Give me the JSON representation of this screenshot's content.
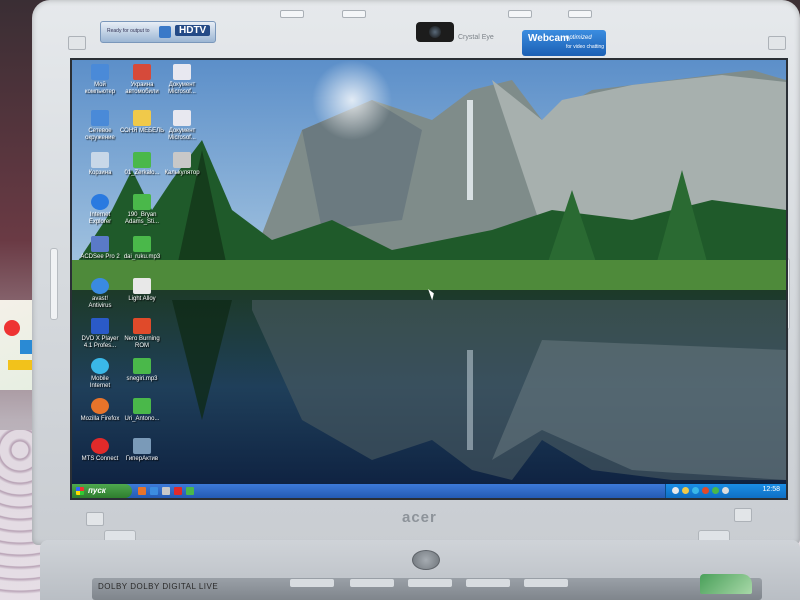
{
  "bezel": {
    "brand": "acer",
    "camera_label": "Crystal Eye",
    "hdtv_sticker": {
      "small_text": "Ready for output to",
      "badge": "HDTV"
    },
    "webcam_sticker": {
      "title": "Webcam",
      "line1": "optimized",
      "line2": "for video chatting"
    },
    "base_label": "DOLBY DOLBY DIGITAL LIVE"
  },
  "desktop": {
    "icons": [
      {
        "label": "Мой\nкомпьютер",
        "color": "#4a8ad8"
      },
      {
        "label": "Украина\nавтомобили",
        "color": "#d64a3a"
      },
      {
        "label": "Документ\nMicrosof...",
        "color": "#e8e8f0"
      },
      {
        "label": "Сетевое\nокружение",
        "color": "#4a8ad8"
      },
      {
        "label": "СОНЯ МЕБЕЛЬ",
        "color": "#f0c94a"
      },
      {
        "label": "Документ\nMicrosof...",
        "color": "#e8e8f0"
      },
      {
        "label": "Корзина",
        "color": "#c8d8e8"
      },
      {
        "label": "01_Zerkalo...",
        "color": "#4ab84a"
      },
      {
        "label": "Калькулятор",
        "color": "#c8c8c8"
      },
      {
        "label": "Internet\nExplorer",
        "color": "#2a7ae0"
      },
      {
        "label": "190_Bryan\nAdams_Sti...",
        "color": "#4ab84a"
      },
      {
        "label": "ACDSee Pro 2",
        "color": "#5a7ac8"
      },
      {
        "label": "dai_ruku.mp3",
        "color": "#4ab84a"
      },
      {
        "label": "avast!\nAntivirus",
        "color": "#3a8ae0"
      },
      {
        "label": "Light Alloy",
        "color": "#e8e8e8"
      },
      {
        "label": "DVD X Player\n4.1 Profes...",
        "color": "#2a5ac8"
      },
      {
        "label": "Nero Burning\nROM",
        "color": "#e04a2a"
      },
      {
        "label": "Mobile\nInternet",
        "color": "#3ab8e8"
      },
      {
        "label": "snegiri.mp3",
        "color": "#4ab84a"
      },
      {
        "label": "Mozilla Firefox",
        "color": "#e8742a"
      },
      {
        "label": "Uri_Antono...",
        "color": "#4ab84a"
      },
      {
        "label": "MTS Connect",
        "color": "#e02a2a"
      },
      {
        "label": "ГиперАктив",
        "color": "#7a9ab8"
      }
    ]
  },
  "taskbar": {
    "start_label": "пуск",
    "clock": "12:58"
  }
}
